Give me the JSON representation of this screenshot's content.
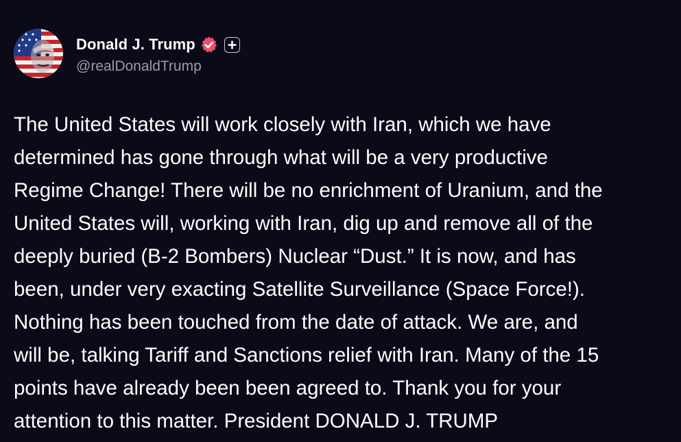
{
  "author": {
    "display_name": "Donald J. Trump",
    "handle": "@realDonaldTrump",
    "verified": true,
    "verified_color": "#ee4e6a",
    "follow_icon": "plus-icon",
    "avatar_icon": "profile-avatar-flag-face"
  },
  "post": {
    "text": "The United States will work closely with Iran, which we have\ndetermined has gone through what will be a very productive\nRegime Change! There will be no enrichment of Uranium, and the\nUnited States will, working with Iran, dig up and remove all of the\ndeeply buried (B-2 Bombers) Nuclear “Dust.” It is now, and has\nbeen, under very exacting Satellite Surveillance (Space Force!).\nNothing has been touched from the date of attack. We are, and\nwill be, talking Tariff and Sanctions relief with Iran. Many of the 15\npoints have already been been agreed to. Thank you for your\nattention to this matter. President DONALD J. TRUMP"
  },
  "theme": {
    "background": "#0b0a18",
    "text": "#ffffff",
    "muted": "#9a9aaa"
  }
}
